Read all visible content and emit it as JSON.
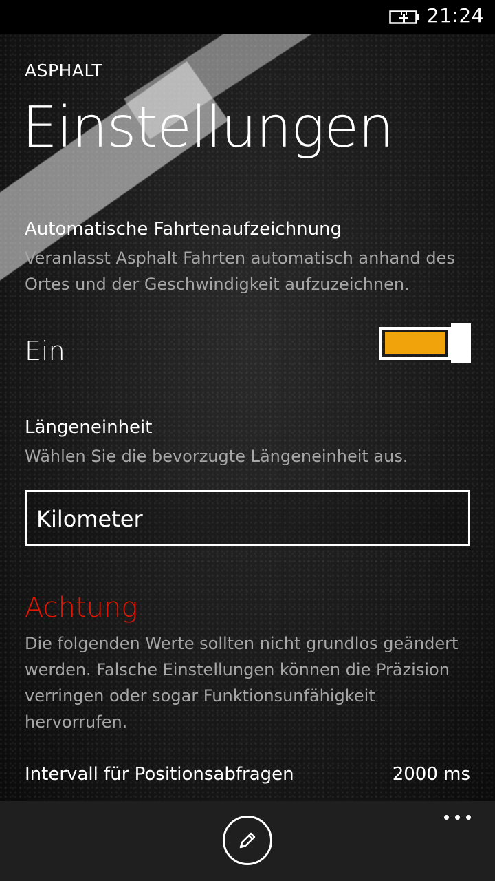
{
  "status": {
    "time": "21:24",
    "battery_icon": "battery-charging-icon"
  },
  "header": {
    "app_title": "ASPHALT",
    "page_title": "Einstellungen"
  },
  "auto_recording": {
    "title": "Automatische Fahrtenaufzeichnung",
    "description": "Veranlasst Asphalt Fahrten automatisch anhand des Ortes und der Geschwindigkeit aufzuzeichnen.",
    "toggle_label": "Ein",
    "toggle_on": true,
    "accent": "#f0a30a"
  },
  "length_unit": {
    "title": "Längeneinheit",
    "description": "Wählen Sie die bevorzugte Längeneinheit aus.",
    "selected": "Kilometer"
  },
  "warning": {
    "title": "Achtung",
    "color": "#e51400",
    "description": "Die folgenden Werte sollten nicht grundlos geändert werden. Falsche Einstellungen können die Präzision verringen oder sogar Funktionsunfähigkeit hervorrufen."
  },
  "interval": {
    "label": "Intervall für Positionsabfragen",
    "value": "2000 ms"
  },
  "appbar": {
    "edit_icon": "edit-icon",
    "more_icon": "more-icon"
  }
}
